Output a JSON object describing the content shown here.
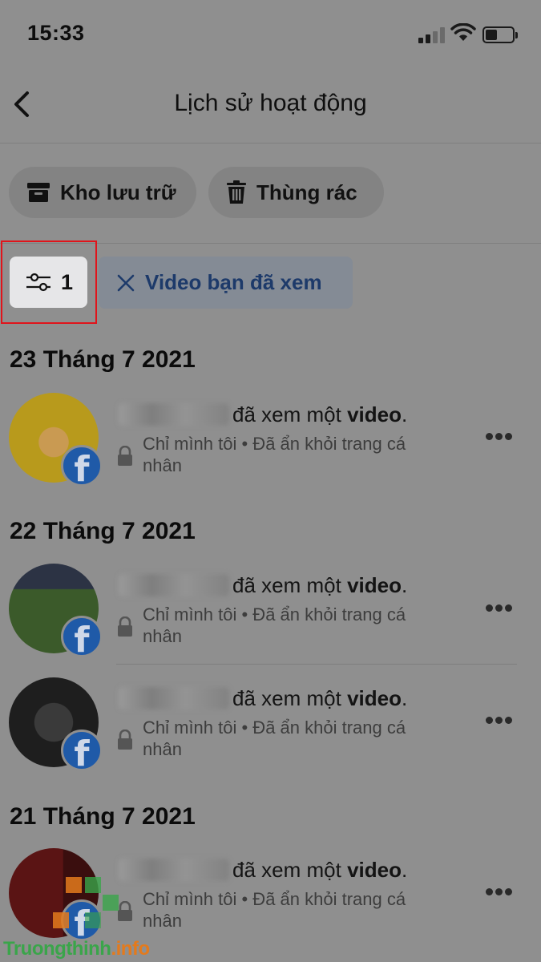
{
  "status_bar": {
    "time": "15:33"
  },
  "header": {
    "title": "Lịch sử hoạt động"
  },
  "tabs": [
    {
      "label": "Kho lưu trữ",
      "icon": "archive-icon"
    },
    {
      "label": "Thùng rác",
      "icon": "trash-icon"
    }
  ],
  "filter": {
    "count": "1",
    "chip_label": "Video bạn đã xem"
  },
  "groups": [
    {
      "date": "23 Tháng 7 2021",
      "items": [
        {
          "prefix": "đã xem một",
          "object": "video",
          "suffix": ".",
          "meta": "Chỉ mình tôi • Đã ẩn khỏi trang cá nhân",
          "avatar_color": "#b89a1c"
        }
      ]
    },
    {
      "date": "22 Tháng 7 2021",
      "items": [
        {
          "prefix": "đã xem một",
          "object": "video",
          "suffix": ".",
          "meta": "Chỉ mình tôi • Đã ẩn khỏi trang cá nhân",
          "avatar_color": "#3b5a2a"
        },
        {
          "prefix": "đã xem một",
          "object": "video",
          "suffix": ".",
          "meta": "Chỉ mình tôi • Đã ẩn khỏi trang cá nhân",
          "avatar_color": "#1e1e1e"
        }
      ]
    },
    {
      "date": "21 Tháng 7 2021",
      "items": [
        {
          "prefix": "đã xem một",
          "object": "video",
          "suffix": ".",
          "meta": "Chỉ mình tôi • Đã ẩn khỏi trang cá nhân",
          "avatar_color": "#5a1414"
        }
      ]
    }
  ],
  "watermark": {
    "main": "Truongthinh",
    "tld": ".info"
  },
  "colors": {
    "highlight": "#e0141b",
    "facebook": "#1f5aa8",
    "chip_text": "#1d3a6a"
  }
}
